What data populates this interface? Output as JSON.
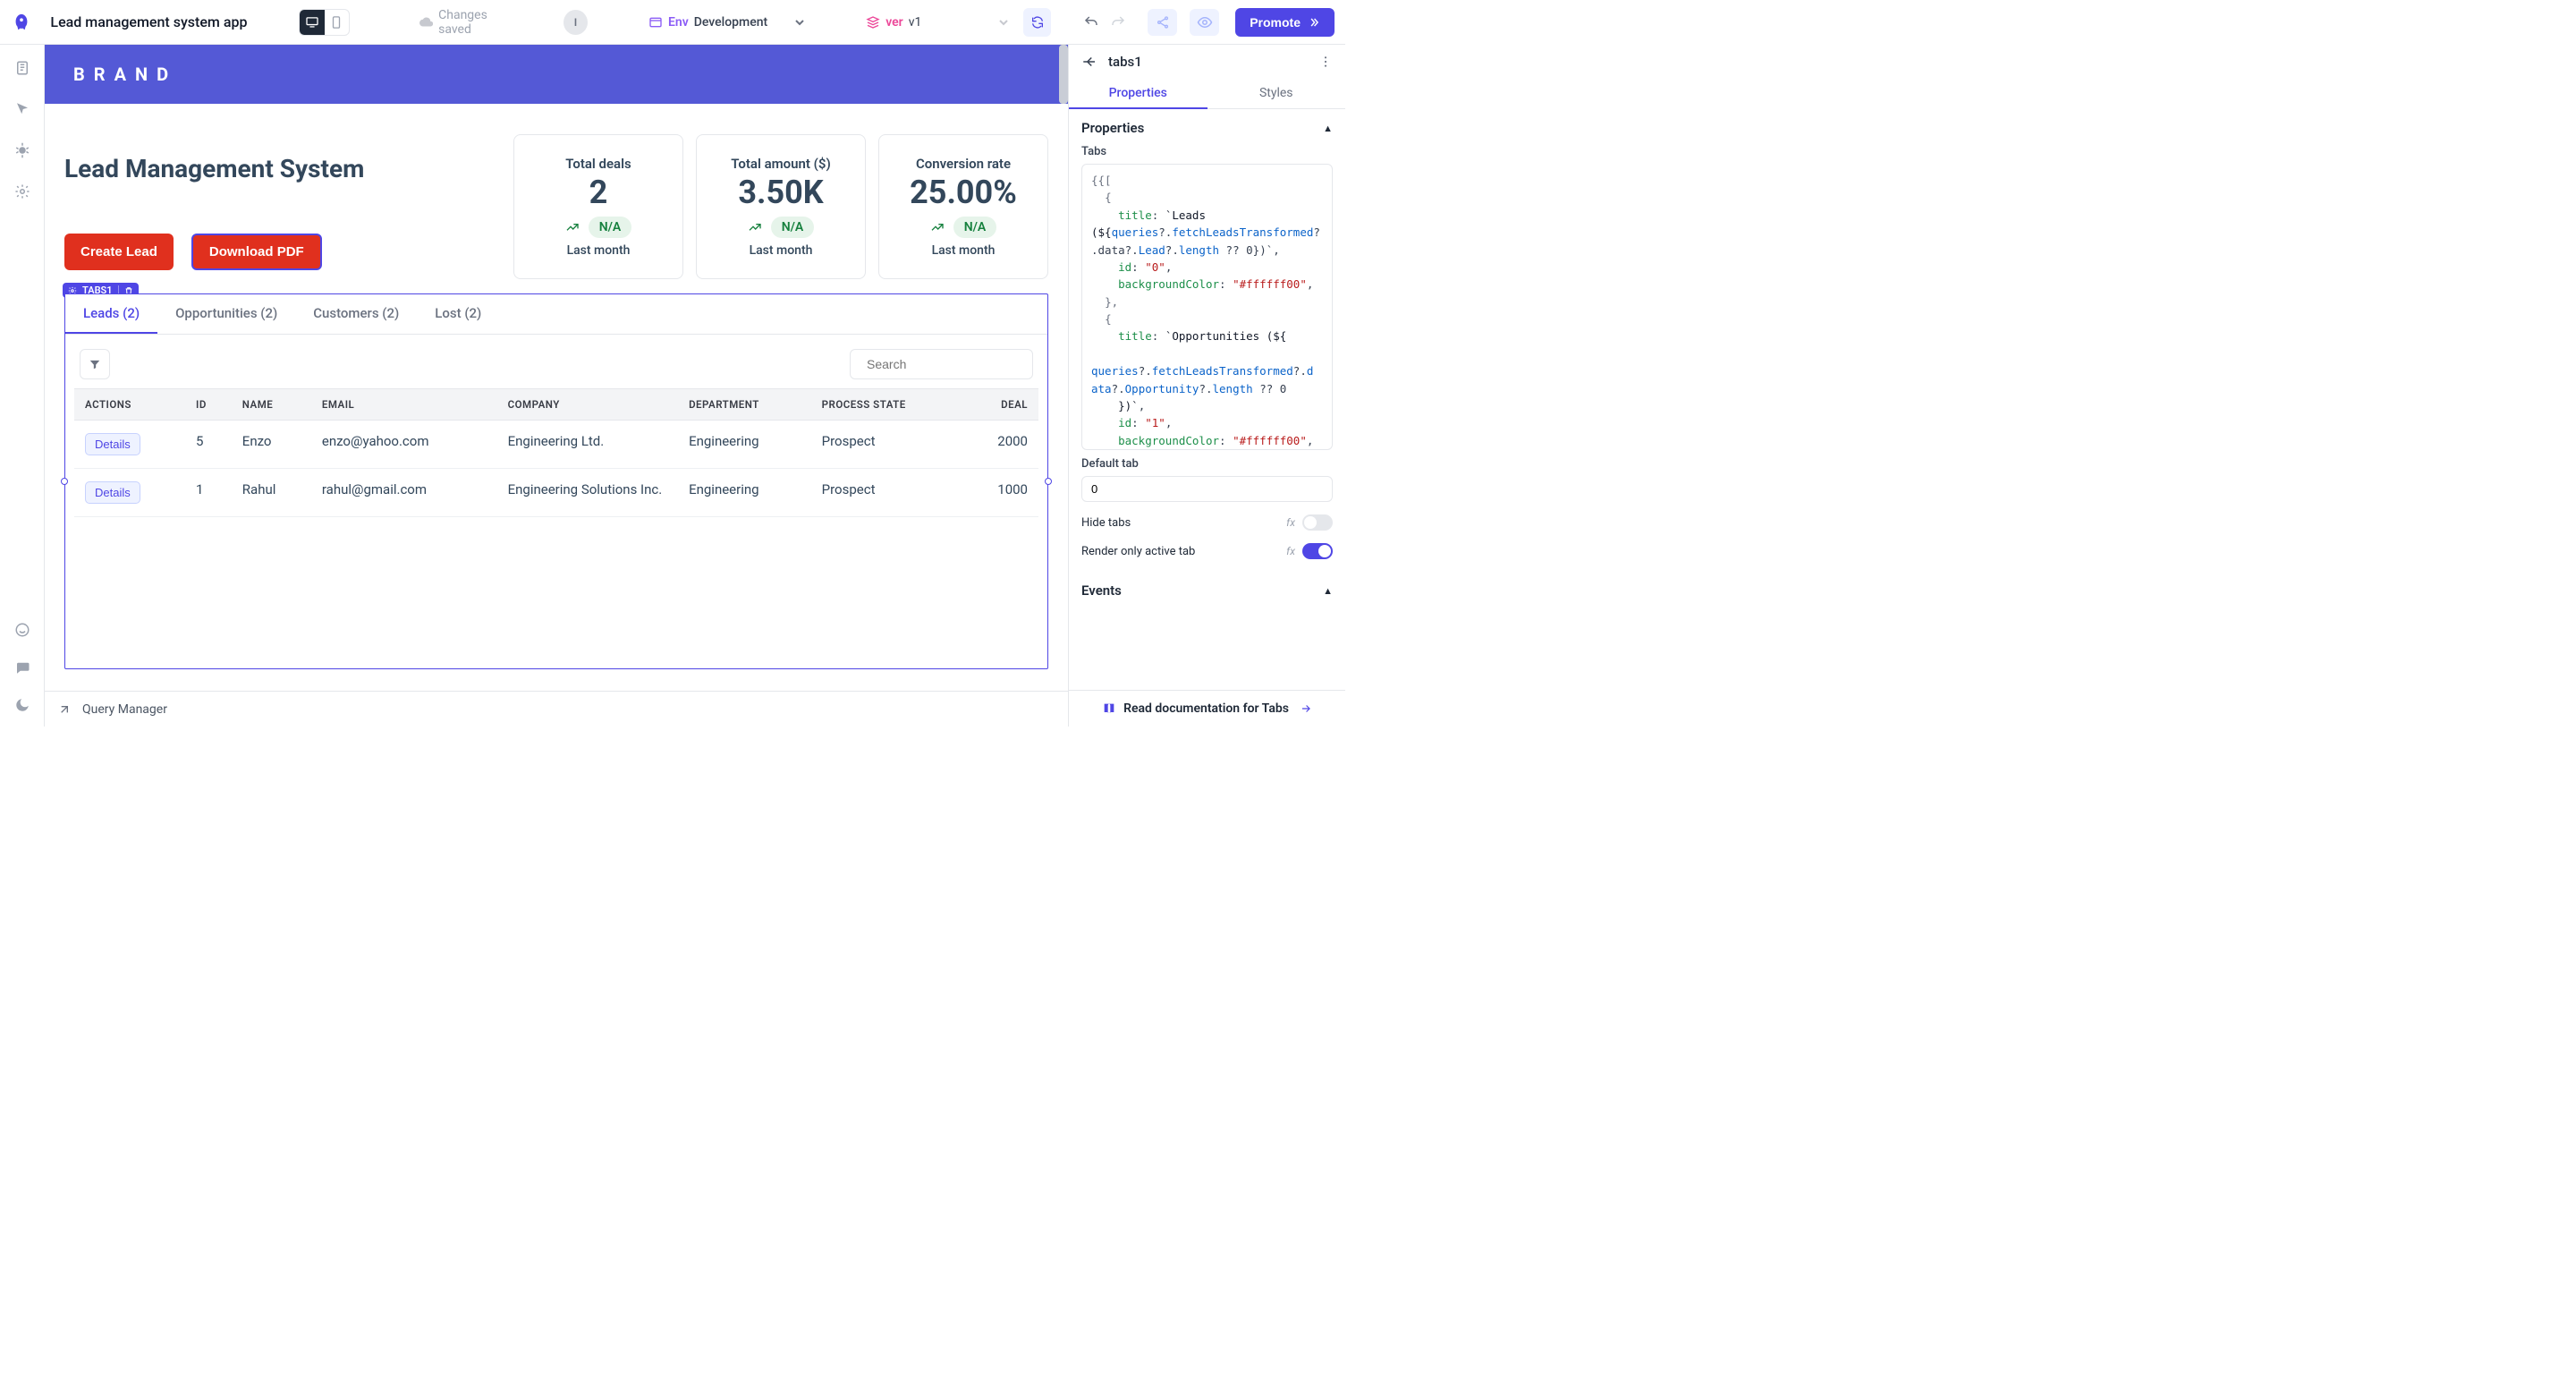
{
  "topbar": {
    "app_name": "Lead management system app",
    "saved_text": "Changes saved",
    "i_badge": "I",
    "env_prefix": "Env",
    "env_value": "Development",
    "ver_prefix": "ver",
    "ver_value": "v1",
    "promote_label": "Promote"
  },
  "brand": "BRAND",
  "page_title": "Lead Management System",
  "buttons": {
    "create_lead": "Create Lead",
    "download_pdf": "Download PDF"
  },
  "stats": [
    {
      "label": "Total deals",
      "value": "2",
      "change": "N/A",
      "sub": "Last month"
    },
    {
      "label": "Total amount ($)",
      "value": "3.50K",
      "change": "N/A",
      "sub": "Last month"
    },
    {
      "label": "Conversion rate",
      "value": "25.00%",
      "change": "N/A",
      "sub": "Last month"
    }
  ],
  "selected_component": "TABS1",
  "tabs": [
    {
      "label": "Leads (2)"
    },
    {
      "label": "Opportunities (2)"
    },
    {
      "label": "Customers (2)"
    },
    {
      "label": "Lost (2)"
    }
  ],
  "table": {
    "search_placeholder": "Search",
    "columns": [
      "ACTIONS",
      "ID",
      "NAME",
      "EMAIL",
      "COMPANY",
      "DEPARTMENT",
      "PROCESS STATE",
      "DEAL"
    ],
    "details_label": "Details",
    "rows": [
      {
        "id": "5",
        "name": "Enzo",
        "email": "enzo@yahoo.com",
        "company": "Engineering Ltd.",
        "department": "Engineering",
        "state": "Prospect",
        "deal": "2000"
      },
      {
        "id": "1",
        "name": "Rahul",
        "email": "rahul@gmail.com",
        "company": "Engineering Solutions Inc.",
        "department": "Engineering",
        "state": "Prospect",
        "deal": "1000"
      }
    ]
  },
  "query_manager": "Query Manager",
  "rightpanel": {
    "title": "tabs1",
    "tabs": {
      "properties": "Properties",
      "styles": "Styles"
    },
    "section_properties": "Properties",
    "label_tabs": "Tabs",
    "default_tab_label": "Default tab",
    "default_tab_value": "0",
    "hide_tabs_label": "Hide tabs",
    "render_only_label": "Render only active tab",
    "section_events": "Events",
    "doc_text": "Read documentation for Tabs"
  }
}
